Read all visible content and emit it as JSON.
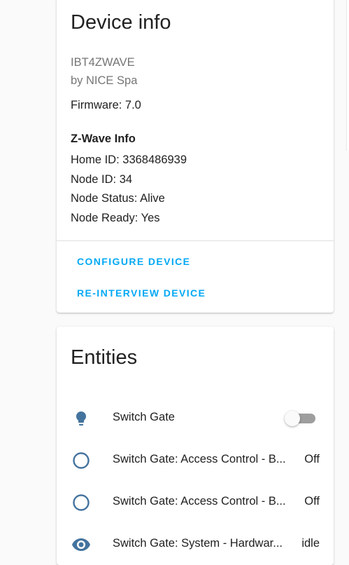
{
  "device_info": {
    "title": "Device info",
    "model": "IBT4ZWAVE",
    "manufacturer": "by NICE Spa",
    "firmware": "Firmware: 7.0",
    "zwave": {
      "heading": "Z-Wave Info",
      "home_id": "Home ID: 3368486939",
      "node_id": "Node ID: 34",
      "node_status": "Node Status: Alive",
      "node_ready": "Node Ready: Yes"
    },
    "actions": {
      "configure": "CONFIGURE DEVICE",
      "reinterview": "RE-INTERVIEW DEVICE"
    }
  },
  "entities": {
    "title": "Entities",
    "items": [
      {
        "icon": "lightbulb-icon",
        "name": "Switch Gate",
        "control": "toggle",
        "toggle_on": false
      },
      {
        "icon": "circle-outline-icon",
        "name": "Switch Gate: Access Control - B...",
        "state": "Off"
      },
      {
        "icon": "circle-outline-icon",
        "name": "Switch Gate: Access Control - B...",
        "state": "Off"
      },
      {
        "icon": "eye-icon",
        "name": "Switch Gate: System - Hardwar...",
        "state": "idle"
      }
    ]
  },
  "colors": {
    "accent": "#03a9f4",
    "icon": "#44739e",
    "text_secondary": "#757575"
  }
}
